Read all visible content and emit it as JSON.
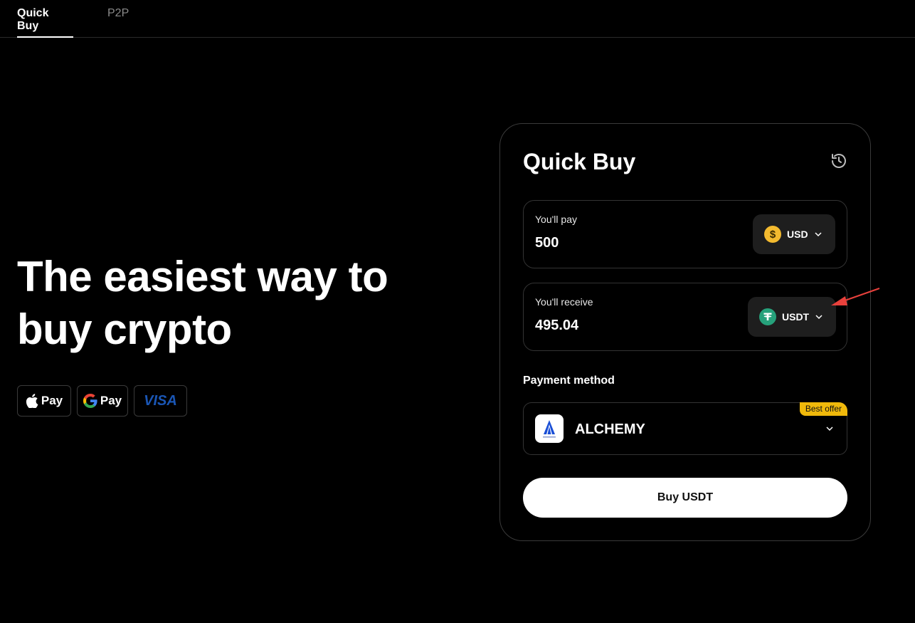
{
  "nav": {
    "tabs": [
      {
        "label": "Quick Buy",
        "active": true
      },
      {
        "label": "P2P",
        "active": false
      }
    ]
  },
  "hero": {
    "line1": "The easiest way to",
    "line2": "buy crypto"
  },
  "payment_badges": {
    "apple_pay": "Pay",
    "google_pay": "Pay",
    "visa": "VISA"
  },
  "card": {
    "title": "Quick Buy",
    "pay": {
      "label": "You'll pay",
      "value": "500",
      "currency": "USD",
      "currency_icon": "dollar-coin-icon"
    },
    "receive": {
      "label": "You'll receive",
      "value": "495.04",
      "currency": "USDT",
      "currency_icon": "tether-icon"
    },
    "payment_method": {
      "label": "Payment method",
      "provider": "ALCHEMY",
      "provider_logo_text": "Alchemy Pay",
      "badge": "Best offer"
    },
    "buy_button": "Buy USDT"
  },
  "colors": {
    "background": "#000000",
    "accent_yellow": "#f0b90b",
    "usdt_green": "#26a17b",
    "annotation_arrow": "#e8413c"
  }
}
